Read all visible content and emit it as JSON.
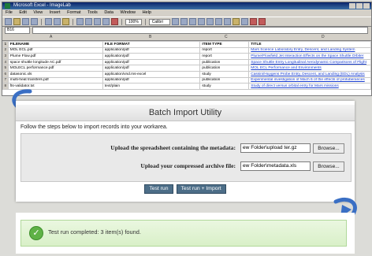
{
  "excel": {
    "title": "Microsoft Excel - ImageLab",
    "menu": [
      "File",
      "Edit",
      "View",
      "Insert",
      "Format",
      "Tools",
      "Data",
      "Window",
      "Help"
    ],
    "name_box": "B16",
    "zoom": "100%",
    "font": "Calibri",
    "column_letters": [
      "A",
      "B",
      "C",
      "D"
    ],
    "headers": [
      "FILENAME",
      "FILE FORMAT",
      "ITEM TYPE",
      "TITLE"
    ],
    "rows": [
      [
        "MOL ECL.pdf",
        "application/pdf",
        "report",
        "Mars Science Laboratory Entry, Descent, and Landing System"
      ],
      [
        "Plume Flow.pdf",
        "application/pdf",
        "report",
        "Plume/Flowfield Jet Interaction Effects on the Space Shuttle Orbiter"
      ],
      [
        "space shuttle longitude AC.pdf",
        "application/pdf",
        "publication",
        "Space Shuttle Entry Longitudinal Aerodynamic Comparisons of Flight"
      ],
      [
        "MOLECL performance.pdf",
        "application/pdf",
        "publication",
        "MOL ECL Performance and Environments"
      ],
      [
        "datasonic.xls",
        "application/vnd.ms-excel",
        "study",
        "Cassini/Huygens Probe Entry, Descent, and Landing (EDL) Analysis"
      ],
      [
        "multi-heat transfers.pdf",
        "application/pdf",
        "publication",
        "Experimental investigation of Mach 6 of the effects of protuberances"
      ],
      [
        "fts-validator.txt",
        "text/plain",
        "study",
        "Study of direct versus orbital entry for Mars missions"
      ]
    ]
  },
  "panel": {
    "title": "Batch Import Utility",
    "intro": "Follow the steps below to import records into your workarea.",
    "upload_sheet_label": "Upload the spreadsheet containing the metadata:",
    "upload_sheet_value": "ew Folder\\upload ter.gz",
    "upload_archive_label": "Upload your compressed archive file:",
    "upload_archive_value": "ew Folder\\metadata.xls",
    "browse_label": "Browse...",
    "test_run_label": "Test run",
    "test_run_import_label": "Test run + Import"
  },
  "success": {
    "message": "Test run completed: 3 item(s) found."
  },
  "colors": {
    "button": "#4d6e88",
    "arrow": "#3a6fc4",
    "success_bg": "#dff3d0",
    "check": "#5fb246"
  }
}
